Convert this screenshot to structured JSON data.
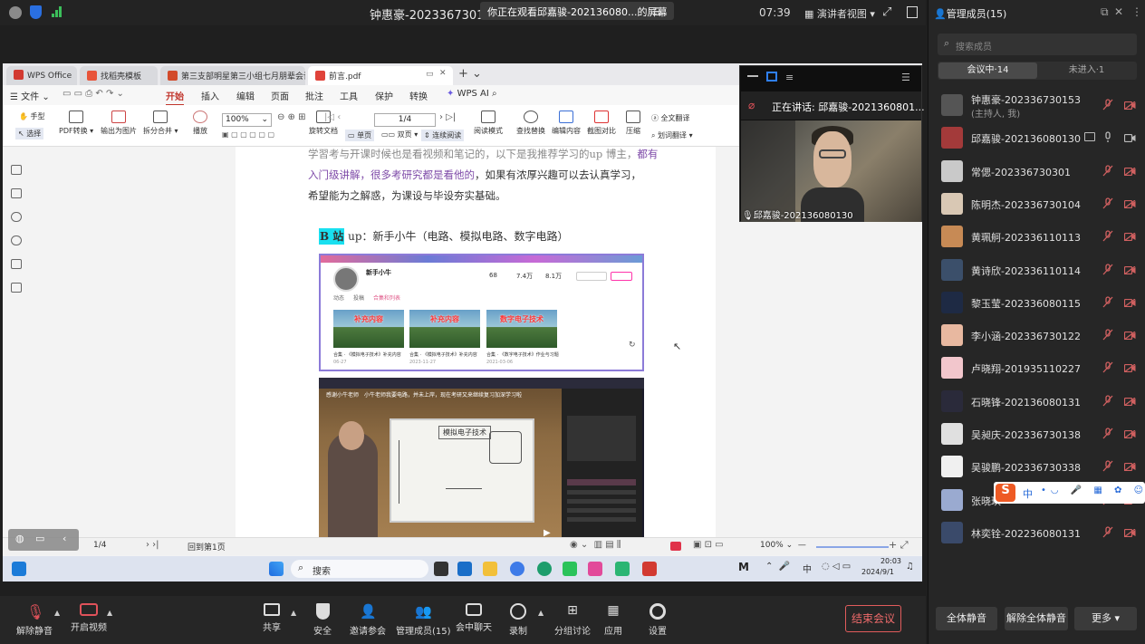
{
  "topbar": {
    "title": "钟惠豪-2023367301531",
    "share_banner": "你正在观看邱嘉骏-202136080...的屏幕",
    "time": "07:39",
    "view_mode": "演讲者视图"
  },
  "wps": {
    "tabs": [
      {
        "label": "WPS Office"
      },
      {
        "label": "找稻壳模板"
      },
      {
        "label": "第三支部明星第三小组七月朋辈会议..."
      },
      {
        "label": "前言.pdf"
      }
    ],
    "menu": {
      "file": "文件",
      "items": [
        "开始",
        "插入",
        "编辑",
        "页面",
        "批注",
        "工具",
        "保护",
        "转换"
      ],
      "wps_ai": "WPS AI"
    },
    "ribbon": {
      "hand": "手型",
      "select": "选择",
      "pdf_convert": "PDF转换",
      "export_image": "输出为图片",
      "split_merge": "拆分合并",
      "play": "播放",
      "zoom": "100%",
      "page": "1/4",
      "rotate": "旋转文档",
      "single_page": "单页",
      "double_page": "双页",
      "continuous": "连续阅读",
      "read_mode": "阅读模式",
      "find_replace": "查找替换",
      "edit_content": "编辑内容",
      "screenshot_compare": "截图对比",
      "compress": "压缩",
      "full_translate": "全文翻译",
      "word_translate": "划词翻译"
    },
    "doc": {
      "line1": "学習考与开课时候也是看视频和笔记的，以下是我推荐学习的up 博主，",
      "line1_purple": "都有",
      "line2_purple": "入门级讲解，很多考研究都是看他的",
      "line2": "，如果有浓厚兴趣可以去认真学习，",
      "line3": "希望能为之解惑，为课设与毕设夯实基础。",
      "bili_label": "B 站",
      "bili_rest": " up：新手小牛（电路、模拟电路、数字电路）",
      "card": {
        "channel": "新手小牛",
        "stats": [
          "68",
          "7.4万",
          "8.1万"
        ],
        "tabs": [
          "动态",
          "投稿",
          "合集和列表"
        ],
        "thumbs": [
          "补充内容",
          "补充内容",
          "数字电子技术"
        ],
        "captions": [
          "合集 · 《模拟电子技术》补充内容",
          "合集 · 《模拟电子技术》补充内容",
          "合集 · 《数字电子技术》作业与习题"
        ],
        "dates": [
          "06-27",
          "2023-11-27",
          "2021-03-06"
        ]
      },
      "video": {
        "danmaku1": "小牛老师我要电路，并未上岸，现在考研又来继续复习加深学习啦",
        "danmaku2": "感谢小牛老师",
        "board_title": "模拟电子技术"
      }
    },
    "status": {
      "page": "1/4",
      "back": "回到第1页",
      "zoom": "100%"
    }
  },
  "camera": {
    "speaking_label": "正在讲话: 邱嘉骏-2021360801...",
    "name": "邱嘉骏-202136080130"
  },
  "taskbar": {
    "search": "搜索",
    "lang": "中",
    "time": "20:03",
    "date": "2024/9/1"
  },
  "panel": {
    "title": "管理成员(15)",
    "search_placeholder": "搜索成员",
    "tab_in_meeting": "会议中·14",
    "tab_not_joined": "未进入·1",
    "members": [
      {
        "name": "钟惠豪-202336730153",
        "sub": "(主持人, 我)",
        "color": "#555555"
      },
      {
        "name": "邱嘉骏-202136080130",
        "color": "#a33a3a"
      },
      {
        "name": "常偲-202336730301",
        "color": "#c9c9c9"
      },
      {
        "name": "陈明杰-202336730104",
        "color": "#d9c8b4"
      },
      {
        "name": "黄珮舸-202336110113",
        "color": "#c78a55"
      },
      {
        "name": "黄诗欣-202336110114",
        "color": "#3b4f6a"
      },
      {
        "name": "黎玉莹-202336080115",
        "color": "#1e2a44"
      },
      {
        "name": "李小涵-202336730122",
        "color": "#e8b8a0"
      },
      {
        "name": "卢晓翔-201935110227",
        "color": "#f2c6cc"
      },
      {
        "name": "石晓锋-202136080131",
        "color": "#2a2a3a"
      },
      {
        "name": "吴昶庆-202336730138",
        "color": "#e0e0e0"
      },
      {
        "name": "吴骏鹏-202336730338",
        "color": "#f0f0f0"
      },
      {
        "name": "张晓琪",
        "color": "#9aaad0"
      },
      {
        "name": "林奕铨-202236080131",
        "color": "#3a4a6a"
      }
    ],
    "mute_all": "全体静音",
    "unmute_all": "解除全体静音",
    "more": "更多"
  },
  "bottombar": {
    "unmute": "解除静音",
    "start_video": "开启视频",
    "share": "共享",
    "security": "安全",
    "invite": "邀请参会",
    "members": "管理成员(15)",
    "chat": "会中聊天",
    "record": "录制",
    "breakout": "分组讨论",
    "apps": "应用",
    "settings": "设置",
    "end": "结束会议"
  },
  "ime": {
    "lang": "中"
  }
}
